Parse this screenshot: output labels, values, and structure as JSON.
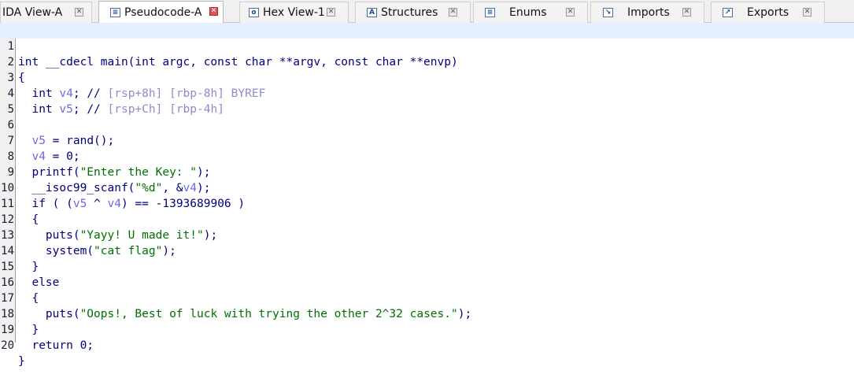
{
  "tabs": [
    {
      "label": "IDA View-A",
      "icon": "graph-view-icon",
      "active": false
    },
    {
      "label": "Pseudocode-A",
      "icon": "pseudocode-icon",
      "active": true
    },
    {
      "label": "Hex View-1",
      "icon": "hex-view-icon",
      "active": false
    },
    {
      "label": "Structures",
      "icon": "structures-icon",
      "active": false
    },
    {
      "label": "Enums",
      "icon": "enums-icon",
      "active": false
    },
    {
      "label": "Imports",
      "icon": "imports-icon",
      "active": false
    },
    {
      "label": "Exports",
      "icon": "exports-icon",
      "active": false
    }
  ],
  "code": {
    "line_numbers": [
      "1",
      "2",
      "3",
      "4",
      "5",
      "6",
      "7",
      "8",
      "9",
      "10",
      "11",
      "12",
      "13",
      "14",
      "15",
      "16",
      "17",
      "18",
      "19",
      "20"
    ],
    "l1": {
      "a": "int __cdecl main(int argc, const char **argv, const char **envp)"
    },
    "l2": {
      "a": "{"
    },
    "l3": {
      "a": "  int ",
      "b": "v4",
      "c": "; // ",
      "d": "[rsp+8h] [rbp-8h] BYREF"
    },
    "l4": {
      "a": "  int ",
      "b": "v5",
      "c": "; // ",
      "d": "[rsp+Ch] [rbp-4h]"
    },
    "l5": {
      "a": ""
    },
    "l6": {
      "a": "  ",
      "b": "v5",
      "c": " = rand();"
    },
    "l7": {
      "a": "  ",
      "b": "v4",
      "c": " = 0;"
    },
    "l8": {
      "a": "  printf(",
      "b": "\"Enter the Key: \"",
      "c": ");"
    },
    "l9": {
      "a": "  __isoc99_scanf(",
      "b": "\"%d\"",
      "c": ", &",
      "d": "v4",
      "e": ");"
    },
    "l10": {
      "a": "  if ( (",
      "b": "v5",
      "c": " ^ ",
      "d": "v4",
      "e": ") == -1393689906 )"
    },
    "l11": {
      "a": "  {"
    },
    "l12": {
      "a": "    puts(",
      "b": "\"Yayy! U made it!\"",
      "c": ");"
    },
    "l13": {
      "a": "    system(",
      "b": "\"cat flag\"",
      "c": ");"
    },
    "l14": {
      "a": "  }"
    },
    "l15": {
      "a": "  else"
    },
    "l16": {
      "a": "  {"
    },
    "l17": {
      "a": "    puts(",
      "b": "\"Oops!, Best of luck with trying the other 2^32 cases.\"",
      "c": ");"
    },
    "l18": {
      "a": "  }"
    },
    "l19": {
      "a": "  return 0;"
    },
    "l20": {
      "a": "}"
    }
  }
}
